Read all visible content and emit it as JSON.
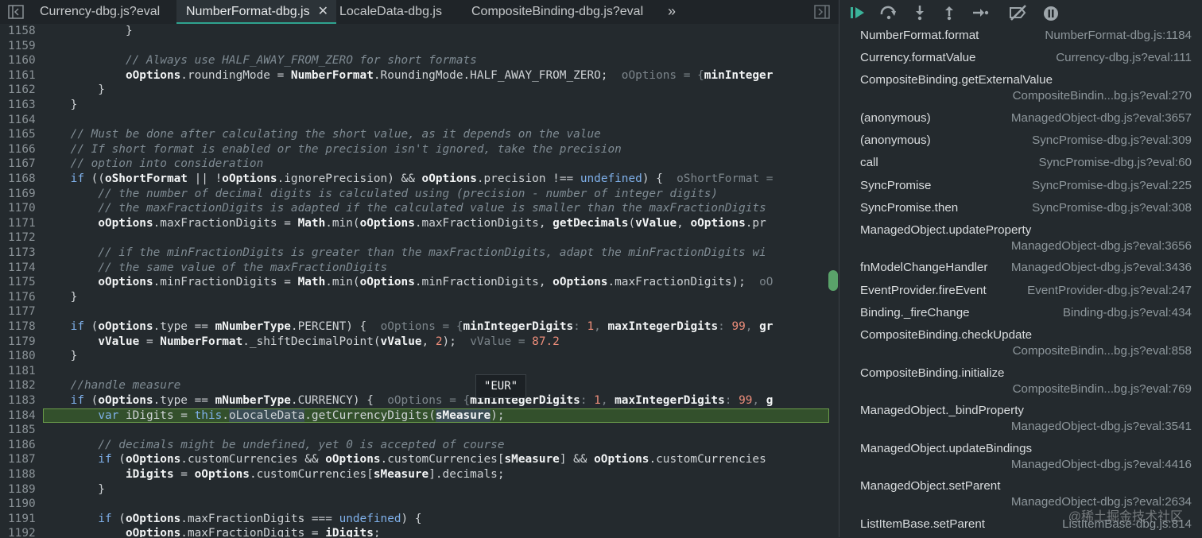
{
  "tabs": [
    {
      "label": "Currency-dbg.js?eval",
      "active": false
    },
    {
      "label": "NumberFormat-dbg.js",
      "active": true
    },
    {
      "label": "LocaleData-dbg.js",
      "active": false
    },
    {
      "label": "CompositeBinding-dbg.js?eval",
      "active": false
    }
  ],
  "tab_close_glyph": "✕",
  "tab_overflow_glyph": "»",
  "tooltip": "\"EUR\"",
  "icons": {
    "toggle_left": "sidebar-toggle-icon",
    "toggle_right": "panel-toggle-icon",
    "resume": "resume-icon",
    "step_over": "step-over-icon",
    "step_into": "step-into-icon",
    "step_out": "step-out-icon",
    "step": "step-icon",
    "deactivate": "deactivate-breakpoints-icon",
    "pause_exceptions": "pause-exceptions-icon"
  },
  "code_lines": [
    {
      "n": "1158",
      "html": "            <span class=\"p\">}</span>"
    },
    {
      "n": "1159",
      "html": ""
    },
    {
      "n": "1160",
      "html": "            <span class=\"cm\">// Always use HALF_AWAY_FROM_ZERO for short formats</span>"
    },
    {
      "n": "1161",
      "html": "            <span class=\"b\">oOptions</span>.roundingMode = <span class=\"b\">NumberFormat</span>.RoundingMode.HALF_AWAY_FROM_ZERO;  <span class=\"inl\">oOptions = {<span class=\"b\">minInteger</span></span>"
    },
    {
      "n": "1162",
      "html": "        }"
    },
    {
      "n": "1163",
      "html": "    }"
    },
    {
      "n": "1164",
      "html": ""
    },
    {
      "n": "1165",
      "html": "    <span class=\"cm\">// Must be done after calculating the short value, as it depends on the value</span>"
    },
    {
      "n": "1166",
      "html": "    <span class=\"cm\">// If short format is enabled or the precision isn't ignored, take the precision</span>"
    },
    {
      "n": "1167",
      "html": "    <span class=\"cm\">// option into consideration</span>"
    },
    {
      "n": "1168",
      "html": "    <span class=\"kw\">if</span> ((<span class=\"b\">oShortFormat</span> || !<span class=\"b\">oOptions</span>.ignorePrecision) &amp;&amp; <span class=\"b\">oOptions</span>.precision !== <span class=\"kw\">undefined</span>) {  <span class=\"inl\">oShortFormat =</span>"
    },
    {
      "n": "1169",
      "html": "        <span class=\"cm\">// the number of decimal digits is calculated using (precision - number of integer digits)</span>"
    },
    {
      "n": "1170",
      "html": "        <span class=\"cm\">// the maxFractionDigits is adapted if the calculated value is smaller than the maxFractionDigits</span>"
    },
    {
      "n": "1171",
      "html": "        <span class=\"b\">oOptions</span>.maxFractionDigits = <span class=\"b\">Math</span>.min(<span class=\"b\">oOptions</span>.maxFractionDigits, <span class=\"b\">getDecimals</span>(<span class=\"b\">vValue</span>, <span class=\"b\">oOptions</span>.pr"
    },
    {
      "n": "1172",
      "html": ""
    },
    {
      "n": "1173",
      "html": "        <span class=\"cm\">// if the minFractionDigits is greater than the maxFractionDigits, adapt the minFractionDigits wi</span>"
    },
    {
      "n": "1174",
      "html": "        <span class=\"cm\">// the same value of the maxFractionDigits</span>"
    },
    {
      "n": "1175",
      "html": "        <span class=\"b\">oOptions</span>.minFractionDigits = <span class=\"b\">Math</span>.min(<span class=\"b\">oOptions</span>.minFractionDigits, <span class=\"b\">oOptions</span>.maxFractionDigits);  <span class=\"inl\">oO</span>"
    },
    {
      "n": "1176",
      "html": "    }"
    },
    {
      "n": "1177",
      "html": ""
    },
    {
      "n": "1178",
      "html": "    <span class=\"kw\">if</span> (<span class=\"b\">oOptions</span>.type == <span class=\"b\">mNumberType</span>.PERCENT) {  <span class=\"inl\">oOptions = {<span class=\"b\">minIntegerDigits</span>: <span class=\"num\">1</span>, <span class=\"b\">maxIntegerDigits</span>: <span class=\"num\">99</span>, <span class=\"b\">gr</span></span>"
    },
    {
      "n": "1179",
      "html": "        <span class=\"b\">vValue</span> = <span class=\"b\">NumberFormat</span>._shiftDecimalPoint(<span class=\"b\">vValue</span>, <span class=\"num\">2</span>);  <span class=\"inl\">vValue = <span class=\"num\">87.2</span></span>"
    },
    {
      "n": "1180",
      "html": "    }"
    },
    {
      "n": "1181",
      "html": ""
    },
    {
      "n": "1182",
      "html": "    <span class=\"cm\">//handle measure</span>"
    },
    {
      "n": "1183",
      "html": "    <span class=\"kw\">if</span> (<span class=\"b\">oOptions</span>.type == <span class=\"b\">mNumberType</span>.CURRENCY) {  <span class=\"inl\">oOptions = {<span class=\"b\">minIntegerDigits</span>: <span class=\"num\">1</span>, <span class=\"b\">maxIntegerDigits</span>: <span class=\"num\">99</span>, <span class=\"b\">g</span></span>"
    },
    {
      "n": "1184",
      "html": "        <span class=\"kw\">var</span> iDigits = <span class=\"kw\">this</span>.<span class=\"hl\">oLocaleData</span>.getCurrencyDigits(<span class=\"b hl\">sMeasure</span>);",
      "current": true
    },
    {
      "n": "1185",
      "html": ""
    },
    {
      "n": "1186",
      "html": "        <span class=\"cm\">// decimals might be undefined, yet 0 is accepted of course</span>"
    },
    {
      "n": "1187",
      "html": "        <span class=\"kw\">if</span> (<span class=\"b\">oOptions</span>.customCurrencies &amp;&amp; <span class=\"b\">oOptions</span>.customCurrencies[<span class=\"b\">sMeasure</span>] &amp;&amp; <span class=\"b\">oOptions</span>.customCurrencies"
    },
    {
      "n": "1188",
      "html": "            <span class=\"b\">iDigits</span> = <span class=\"b\">oOptions</span>.customCurrencies[<span class=\"b\">sMeasure</span>].decimals;"
    },
    {
      "n": "1189",
      "html": "        }"
    },
    {
      "n": "1190",
      "html": ""
    },
    {
      "n": "1191",
      "html": "        <span class=\"kw\">if</span> (<span class=\"b\">oOptions</span>.maxFractionDigits === <span class=\"kw\">undefined</span>) {"
    },
    {
      "n": "1192",
      "html": "            <span class=\"b\">oOptions</span>.maxFractionDigits = <span class=\"b\">iDigits</span>;"
    }
  ],
  "call_stack": [
    {
      "fn": "NumberFormat.format",
      "loc": "NumberFormat-dbg.js:1184",
      "wrap": false
    },
    {
      "fn": "Currency.formatValue",
      "loc": "Currency-dbg.js?eval:111",
      "wrap": false
    },
    {
      "fn": "CompositeBinding.getExternalValue",
      "loc": "CompositeBindin...bg.js?eval:270",
      "wrap": true
    },
    {
      "fn": "(anonymous)",
      "loc": "ManagedObject-dbg.js?eval:3657",
      "wrap": false
    },
    {
      "fn": "(anonymous)",
      "loc": "SyncPromise-dbg.js?eval:309",
      "wrap": false
    },
    {
      "fn": "call",
      "loc": "SyncPromise-dbg.js?eval:60",
      "wrap": false
    },
    {
      "fn": "SyncPromise",
      "loc": "SyncPromise-dbg.js?eval:225",
      "wrap": false
    },
    {
      "fn": "SyncPromise.then",
      "loc": "SyncPromise-dbg.js?eval:308",
      "wrap": false
    },
    {
      "fn": "ManagedObject.updateProperty",
      "loc": "ManagedObject-dbg.js?eval:3656",
      "wrap": true
    },
    {
      "fn": "fnModelChangeHandler",
      "loc": "ManagedObject-dbg.js?eval:3436",
      "wrap": false
    },
    {
      "fn": "EventProvider.fireEvent",
      "loc": "EventProvider-dbg.js?eval:247",
      "wrap": false
    },
    {
      "fn": "Binding._fireChange",
      "loc": "Binding-dbg.js?eval:434",
      "wrap": false
    },
    {
      "fn": "CompositeBinding.checkUpdate",
      "loc": "CompositeBindin...bg.js?eval:858",
      "wrap": true
    },
    {
      "fn": "CompositeBinding.initialize",
      "loc": "CompositeBindin...bg.js?eval:769",
      "wrap": true
    },
    {
      "fn": "ManagedObject._bindProperty",
      "loc": "ManagedObject-dbg.js?eval:3541",
      "wrap": true
    },
    {
      "fn": "ManagedObject.updateBindings",
      "loc": "ManagedObject-dbg.js?eval:4416",
      "wrap": true
    },
    {
      "fn": "ManagedObject.setParent",
      "loc": "ManagedObject-dbg.js?eval:2634",
      "wrap": true
    },
    {
      "fn": "ListItemBase.setParent",
      "loc": "ListItemBase-dbg.js:814",
      "wrap": false
    }
  ],
  "watermark": "@稀土掘金技术社区"
}
